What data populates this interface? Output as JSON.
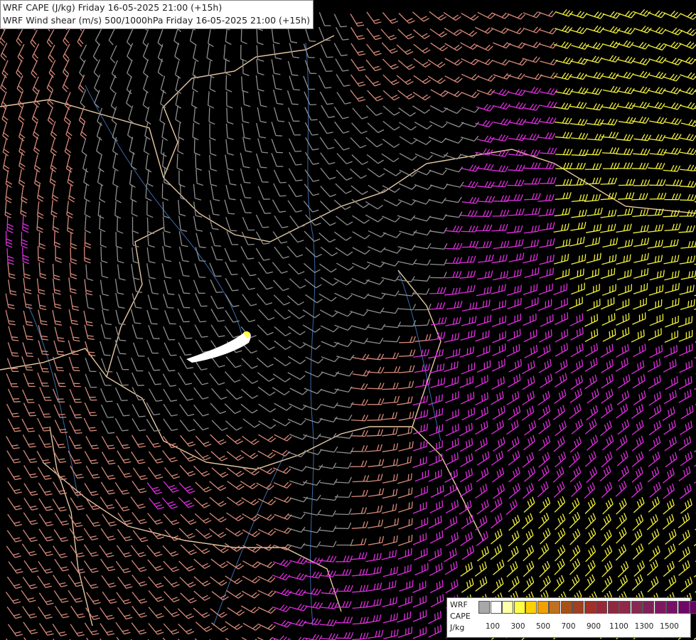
{
  "header": {
    "line1": "WRF CAPE (J/kg) Friday 16-05-2025 21:00 (+15h)",
    "line2": "WRF Wind shear (m/s) 500/1000hPa Friday 16-05-2025 21:00 (+15h)"
  },
  "legend": {
    "label_line1": "WRF",
    "label_line2": "CAPE",
    "label_line3": "J/kg",
    "colors": [
      "#a8a8a8",
      "#ffffff",
      "#ffffaa",
      "#ffff44",
      "#ffd000",
      "#f0a000",
      "#c07020",
      "#a85018",
      "#a04020",
      "#a03028",
      "#982838",
      "#902840",
      "#902848",
      "#882850",
      "#802058",
      "#801860",
      "#781068",
      "#700868",
      "#680060"
    ],
    "ticks": [
      "100",
      "300",
      "500",
      "700",
      "900",
      "1100",
      "1300",
      "1500"
    ]
  },
  "barb_colors": {
    "weak": "#8f8f8f",
    "moderate": "#d88a7a",
    "strong": "#e02ee0",
    "very_strong": "#f2f23a",
    "border": "#e8c8a0",
    "river": "#3a6aa8"
  }
}
